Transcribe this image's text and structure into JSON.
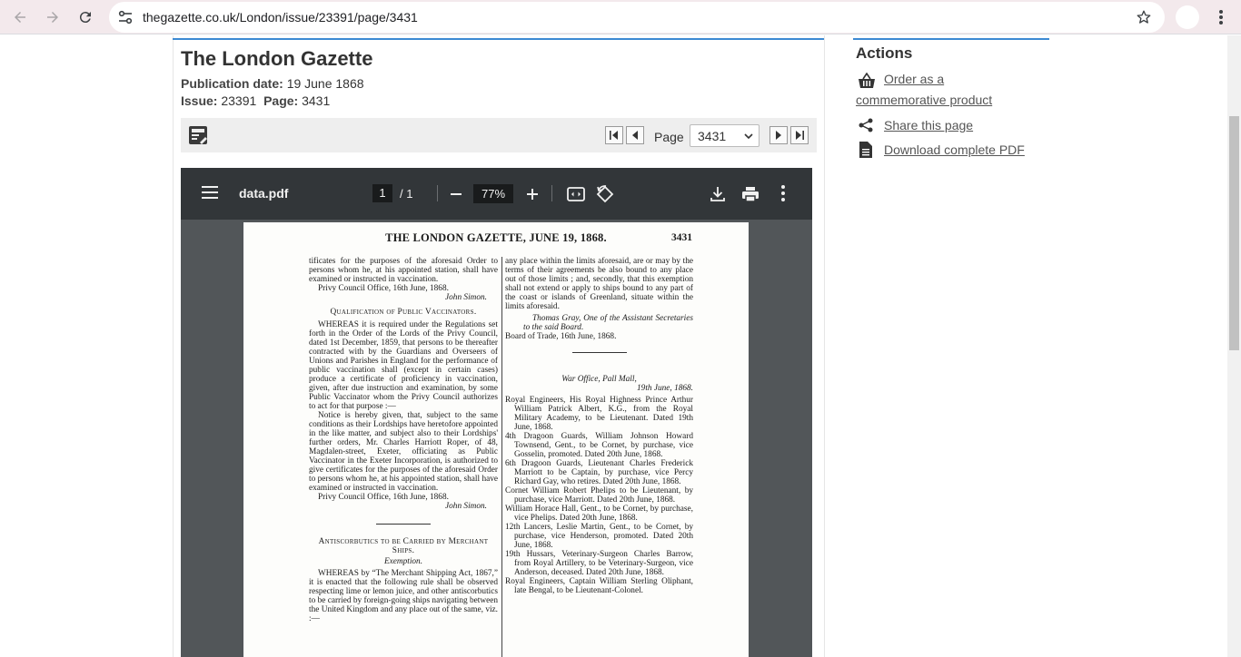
{
  "browser": {
    "url": "thegazette.co.uk/London/issue/23391/page/3431"
  },
  "gazette": {
    "title": "The London Gazette",
    "pub_label": "Publication date:",
    "pub_value": "19 June 1868",
    "issue_label": "Issue:",
    "issue_value": "23391",
    "page_label": "Page:",
    "page_value": "3431"
  },
  "pager": {
    "label": "Page",
    "selected": "3431"
  },
  "actions": {
    "title": "Actions",
    "order": "Order as a commemorative product",
    "share": "Share this page",
    "download": "Download complete PDF"
  },
  "pdf": {
    "filename": "data.pdf",
    "page_current": "1",
    "page_total": "/ 1",
    "zoom": "77%"
  },
  "doc": {
    "header": "THE LONDON GAZETTE, JUNE 19, 1868.",
    "page_number": "3431",
    "left": {
      "p1": "tificates for the purposes of the aforesaid Order to persons whom he, at his appointed station, shall have examined or instructed in vaccination.",
      "p2": "Privy Council Office, 16th June, 1868.",
      "p3": "John Simon.",
      "p4": "Qualification of Public Vaccinators.",
      "p5": "WHEREAS it is required under the Regulations set forth in the Order of the Lords of the Privy Council, dated 1st December, 1859, that persons to be thereafter contracted with by the Guardians and Overseers of Unions and Parishes in England for the performance of public vaccination shall (except in certain cases) produce a certificate of proficiency in vaccination, given, after due instruction and examination, by some Public Vaccinator whom the Privy Council authorizes to act for that purpose :—",
      "p6": "Notice is hereby given, that, subject to the same conditions as their Lordships have heretofore appointed in the like matter, and subject also to their Lordships' further orders, Mr. Charles Harriott Roper, of 48, Magdalen-street, Exeter, officiating as Public Vaccinator in the Exeter Incorporation, is authorized to give certificates for the purposes of the aforesaid Order to persons whom he, at his appointed station, shall have examined or instructed in vaccination.",
      "p7": "Privy Council Office, 16th June, 1868.",
      "p8": "John Simon.",
      "p9": "Antiscorbutics to be Carried by Merchant Ships.",
      "p10": "Exemption.",
      "p11": "WHEREAS by “The Merchant Shipping Act, 1867,” it is enacted that the following rule shall be observed respecting lime or lemon juice, and other antiscorbutics to be carried by foreign-going ships navigating between the United Kingdom and any place out of the same, viz. :—"
    },
    "right": {
      "p1": "any place within the limits aforesaid, are or may by the terms of their agreements be also bound to any place out of those limits ; and, secondly, that this exemption shall not extend or apply to ships bound to any part of the coast or islands of Greenland, situate within the limits aforesaid.",
      "p2": "Thomas Gray, One of the Assistant Secretaries to the said Board.",
      "p3": "Board of Trade, 16th June, 1868.",
      "p4": "War Office, Pall Mall,",
      "p5": "19th June, 1868.",
      "p6": "Royal Engineers, His Royal Highness Prince Arthur William Patrick Albert, K.G., from the Royal Military Academy, to be Lieutenant. Dated 19th June, 1868.",
      "p7": "4th Dragoon Guards, William Johnson Howard Townsend, Gent., to be Cornet, by purchase, vice Gosselin, promoted. Dated 20th June, 1868.",
      "p8": "6th Dragoon Guards, Lieutenant Charles Frederick Marriott to be Captain, by purchase, vice Percy Richard Gay, who retires. Dated 20th June, 1868.",
      "p9": "Cornet William Robert Phelips to be Lieutenant, by purchase, vice Marriott. Dated 20th June, 1868.",
      "p10": "William Horace Hall, Gent., to be Cornet, by purchase, vice Phelips. Dated 20th June, 1868.",
      "p11": "12th Lancers, Leslie Martin, Gent., to be Cornet, by purchase, vice Henderson, promoted. Dated 20th June, 1868.",
      "p12": "19th Hussars, Veterinary-Surgeon Charles Barrow, from Royal Artillery, to be Veterinary-Surgeon, vice Anderson, deceased. Dated 20th June, 1868.",
      "p13": "Royal Engineers, Captain William Sterling Oliphant, late Bengal, to be Lieutenant-Colonel."
    }
  }
}
